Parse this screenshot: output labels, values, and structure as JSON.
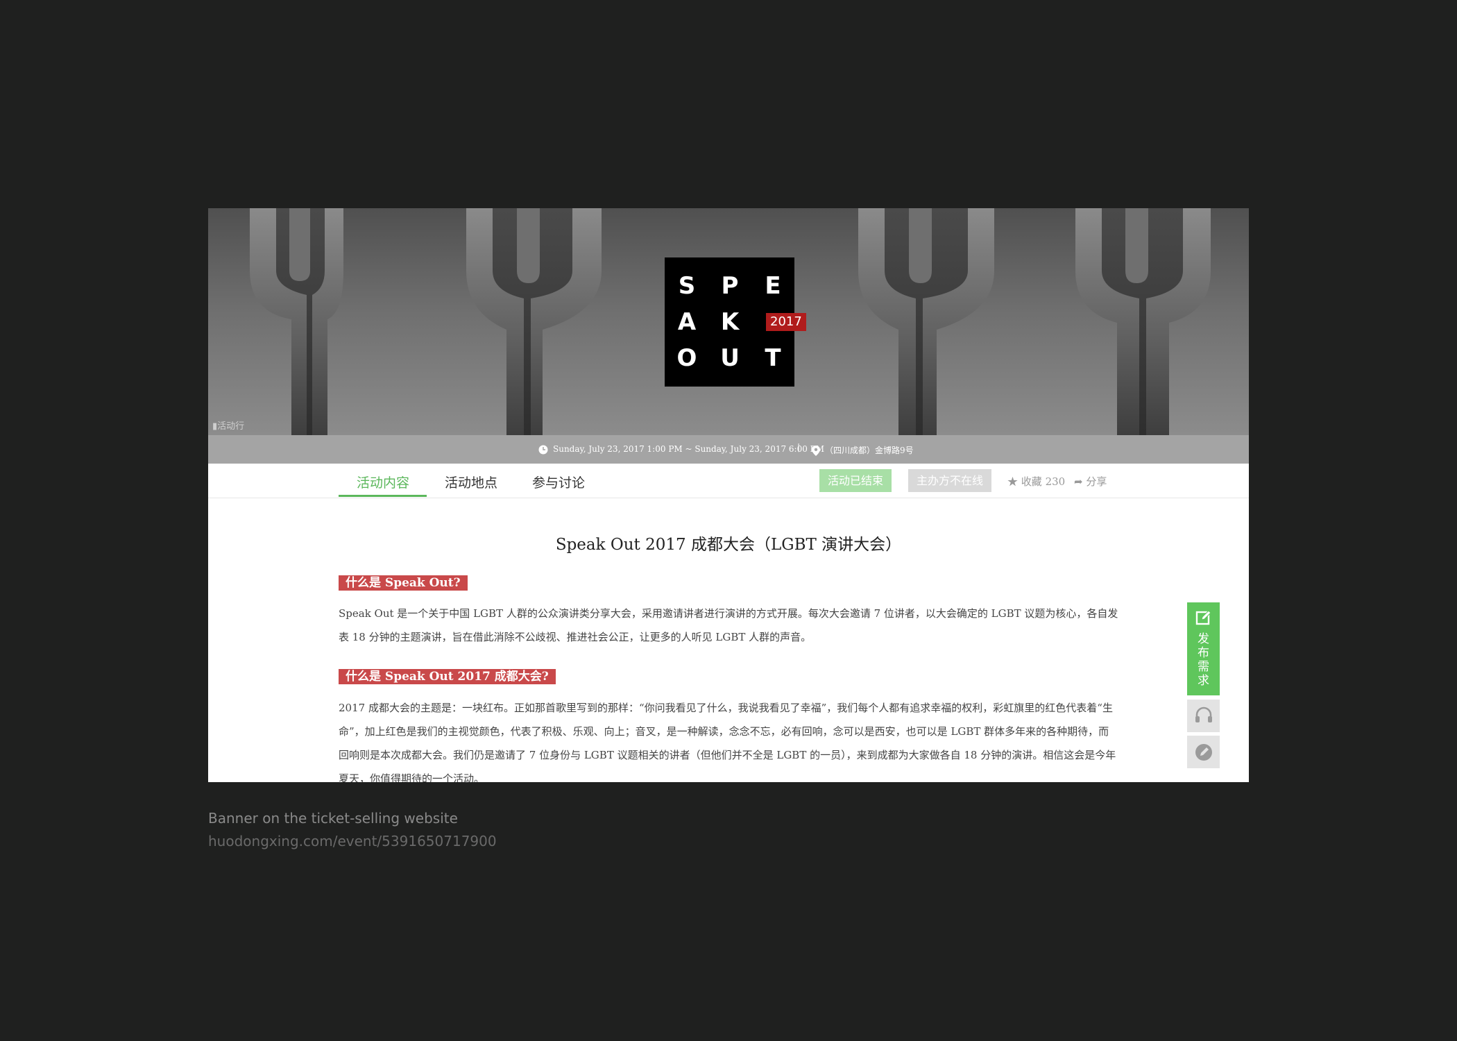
{
  "banner": {
    "logo_letters": [
      "S",
      "P",
      "E",
      "A",
      "K",
      "O",
      "U",
      "T"
    ],
    "logo_year": "2017",
    "watermark": "活动行"
  },
  "infobar": {
    "time": "Sunday, July 23, 2017 1:00 PM ~ Sunday, July 23, 2017 6:00 PM",
    "separator": "|",
    "location": "（四川成都）金博路9号"
  },
  "tabs": [
    {
      "label": "活动内容"
    },
    {
      "label": "活动地点"
    },
    {
      "label": "参与讨论"
    }
  ],
  "status": {
    "ended": "活动已结束",
    "offline": "主办方不在线"
  },
  "actions": {
    "favorite_label": "收藏 230",
    "share_label": "分享"
  },
  "content": {
    "title": "Speak Out 2017 成都大会（LGBT 演讲大会）",
    "heading1": "什么是 Speak Out?",
    "para1": "Speak Out 是一个关于中国 LGBT 人群的公众演讲类分享大会，采用邀请讲者进行演讲的方式开展。每次大会邀请 7 位讲者，以大会确定的 LGBT 议题为核心，各自发表 18 分钟的主题演讲，旨在借此消除不公歧视、推进社会公正，让更多的人听见 LGBT 人群的声音。",
    "heading2": "什么是 Speak Out 2017 成都大会?",
    "para2": "2017 成都大会的主题是：一块红布。正如那首歌里写到的那样：“你问我看见了什么，我说我看见了幸福”，我们每个人都有追求幸福的权利，彩虹旗里的红色代表着“生命”，加上红色是我们的主视觉颜色，代表了积极、乐观、向上；音叉，是一种解读，念念不忘，必有回响，念可以是西安，也可以是 LGBT 群体多年来的各种期待，而回响则是本次成都大会。我们仍是邀请了 7 位身份与 LGBT 议题相关的讲者（但他们并不全是 LGBT 的一员），来到成都为大家做各自 18 分钟的演讲。相信这会是今年夏天，你值得期待的一个活动。"
  },
  "side": {
    "publish_label": "发\n布\n需\n求"
  },
  "caption": {
    "line1": "Banner on the ticket-selling website",
    "line2": "huodongxing.com/event/5391650717900"
  },
  "colors": {
    "accent_green": "#5bb75b",
    "heading_red": "#c9494a",
    "logo_red": "#b01c1c",
    "page_bg": "#1f201f"
  }
}
